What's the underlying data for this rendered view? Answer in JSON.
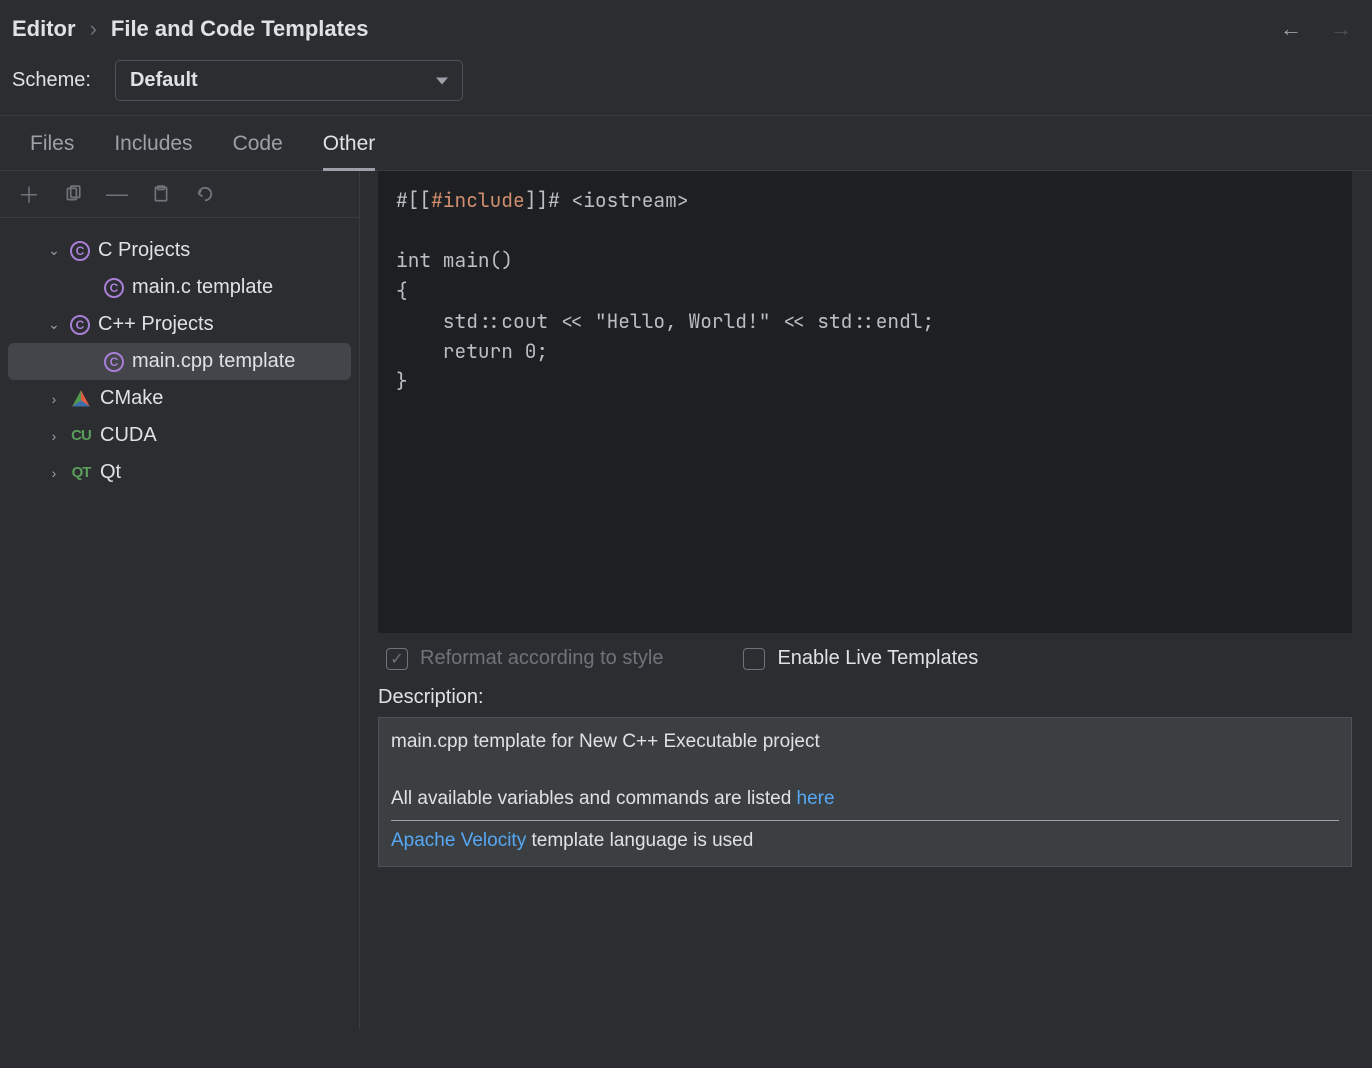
{
  "breadcrumb": {
    "root": "Editor",
    "current": "File and Code Templates"
  },
  "scheme": {
    "label": "Scheme:",
    "value": "Default"
  },
  "tabs": [
    "Files",
    "Includes",
    "Code",
    "Other"
  ],
  "active_tab": "Other",
  "tree": [
    {
      "label": "C Projects",
      "icon": "c",
      "expanded": true,
      "children": [
        {
          "label": "main.c template",
          "icon": "c"
        }
      ]
    },
    {
      "label": "C++ Projects",
      "icon": "c",
      "expanded": true,
      "children": [
        {
          "label": "main.cpp template",
          "icon": "c",
          "selected": true
        }
      ]
    },
    {
      "label": "CMake",
      "icon": "cmake",
      "expanded": false
    },
    {
      "label": "CUDA",
      "icon": "cuda",
      "expanded": false
    },
    {
      "label": "Qt",
      "icon": "qt",
      "expanded": false
    }
  ],
  "code": {
    "l1_a": "#[[",
    "l1_b": "#include",
    "l1_c": "]]# <iostream>",
    "l3": "int main()",
    "l4": "{",
    "l5": "    std::cout << \"Hello, World!\" << std::endl;",
    "l6": "    return 0;",
    "l7": "}"
  },
  "checkboxes": {
    "reformat": "Reformat according to style",
    "live": "Enable Live Templates"
  },
  "description": {
    "label": "Description:",
    "line1": "main.cpp template for New C++ Executable project",
    "line2a": "All available variables and commands are listed ",
    "line2_link": "here",
    "line3_link": "Apache Velocity",
    "line3b": " template language is used"
  }
}
